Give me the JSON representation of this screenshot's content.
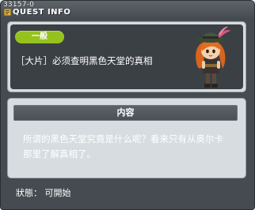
{
  "window": {
    "quest_id": "33157-0",
    "title": "QUEST INFO"
  },
  "quest": {
    "category_badge": "一般",
    "name": "［大片］必须查明黑色天堂的真相",
    "npc_icon": "npc-portrait-girl-with-hat"
  },
  "content": {
    "header": "内容",
    "description_line1": "所谓的黑色天堂究竟是什么呢？看来只有从奥尔卡",
    "description_line2": "那里了解真相了。"
  },
  "footer": {
    "status": "狀態：  可開始"
  },
  "colors": {
    "badge": "#95c21d",
    "panel_bg": "#3b4045",
    "window_bg": "#454b50"
  }
}
